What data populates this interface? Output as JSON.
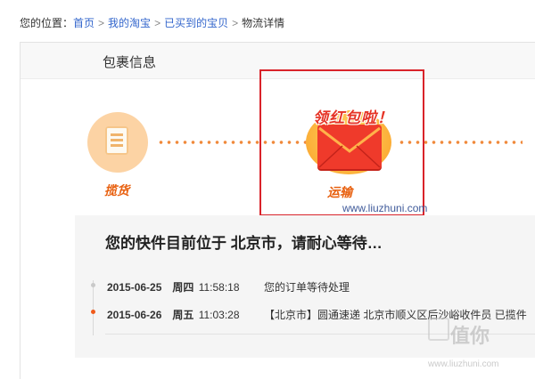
{
  "breadcrumb": {
    "prefix": "您的位置：",
    "items": [
      "首页",
      "我的淘宝",
      "已买到的宝贝"
    ],
    "current": "物流详情",
    "separator": ">"
  },
  "panel": {
    "title": "包裹信息"
  },
  "steps": [
    {
      "label": "揽货",
      "icon": "document-icon"
    },
    {
      "label": "运输",
      "icon": "red-envelope-icon",
      "badge": "领红包啦！"
    }
  ],
  "watermark_url": "www.liuzhuni.com",
  "status": {
    "title": "您的快件目前位于 北京市，请耐心等待…",
    "events": [
      {
        "date": "2015-06-25",
        "weekday": "周四",
        "time": "11:58:18",
        "desc": "您的订单等待处理"
      },
      {
        "date": "2015-06-26",
        "weekday": "周五",
        "time": "11:03:28",
        "desc": "【北京市】圆通速递 北京市顺义区后沙峪收件员 已揽件"
      }
    ]
  },
  "watermark": {
    "logo": "值你",
    "site": "www.liuzhuni.com"
  },
  "colors": {
    "accent": "#f05a1a",
    "link": "#3366cc",
    "highlight_box": "#d9232a"
  }
}
